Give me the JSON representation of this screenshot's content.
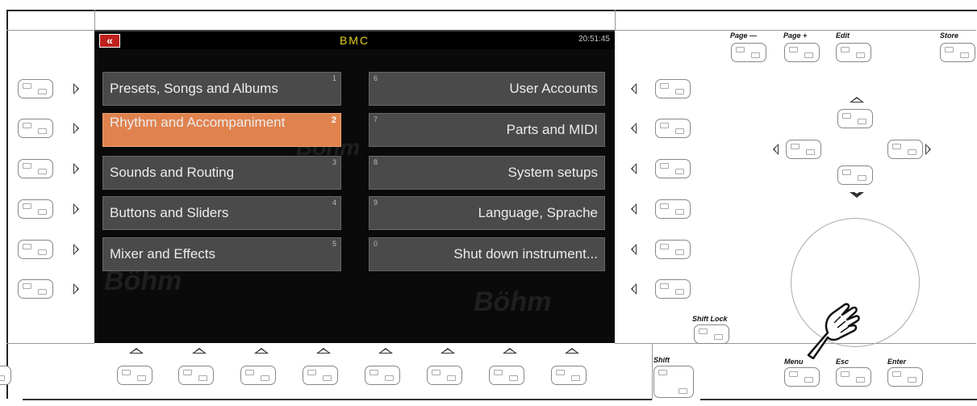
{
  "screen": {
    "title": "BMC",
    "clock": "20:51:45",
    "back_icon": "double-chevron-left-icon",
    "back_glyph": "«",
    "watermark": "Böhm",
    "accent_color": "#e0824e",
    "menu_left": [
      {
        "label": "Presets, Songs and Albums",
        "num": "1",
        "selected": false
      },
      {
        "label": "Rhythm and Accompaniment",
        "num": "2",
        "selected": true
      },
      {
        "label": "Sounds and Routing",
        "num": "3",
        "selected": false
      },
      {
        "label": "Buttons and Sliders",
        "num": "4",
        "selected": false
      },
      {
        "label": "Mixer and Effects",
        "num": "5",
        "selected": false
      }
    ],
    "menu_right": [
      {
        "label": "User Accounts",
        "num": "6"
      },
      {
        "label": "Parts and MIDI",
        "num": "7"
      },
      {
        "label": "System setups",
        "num": "8"
      },
      {
        "label": "Language, Sprache",
        "num": "9"
      },
      {
        "label": "Shut down instrument...",
        "num": "0"
      }
    ]
  },
  "panel": {
    "page_minus": "Page —",
    "page_plus": "Page +",
    "edit": "Edit",
    "store": "Store",
    "shift_lock": "Shift Lock",
    "shift": "Shift",
    "menu": "Menu",
    "esc": "Esc",
    "enter": "Enter",
    "pointer_icon": "pointing-hand-icon"
  }
}
